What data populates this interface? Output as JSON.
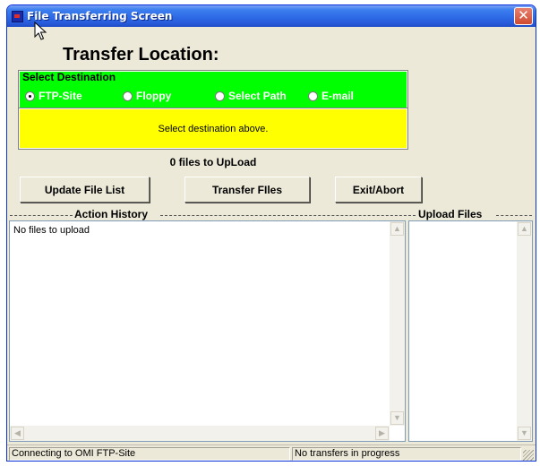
{
  "window": {
    "title": "File Transferring Screen",
    "close_glyph": "✕"
  },
  "main": {
    "heading": "Transfer Location:",
    "destination": {
      "legend": "Select Destination",
      "options": [
        {
          "label": "FTP-Site",
          "selected": true
        },
        {
          "label": "Floppy",
          "selected": false
        },
        {
          "label": "Select Path",
          "selected": false
        },
        {
          "label": "E-mail",
          "selected": false
        }
      ]
    },
    "status_message": "Select destination above.",
    "files_count": "0 files to UpLoad",
    "buttons": {
      "update": "Update File List",
      "transfer": "Transfer FIles",
      "exit": "Exit/Abort"
    },
    "action_history": {
      "label": "Action History",
      "lines": [
        "No files to upload"
      ]
    },
    "upload_files": {
      "label": "Upload Files"
    }
  },
  "statusbar": {
    "connection": "Connecting to OMI FTP-Site",
    "transfer": "No transfers in progress"
  },
  "colors": {
    "destination_bg": "#00ff00",
    "message_bg": "#ffff00",
    "titlebar": "#2e6ae6"
  },
  "icons": {
    "app": "app-icon",
    "close": "close-icon",
    "cursor": "mouse-cursor-icon",
    "scroll_up": "arrow-up-icon",
    "scroll_down": "arrow-down-icon",
    "scroll_left": "arrow-left-icon",
    "scroll_right": "arrow-right-icon"
  }
}
